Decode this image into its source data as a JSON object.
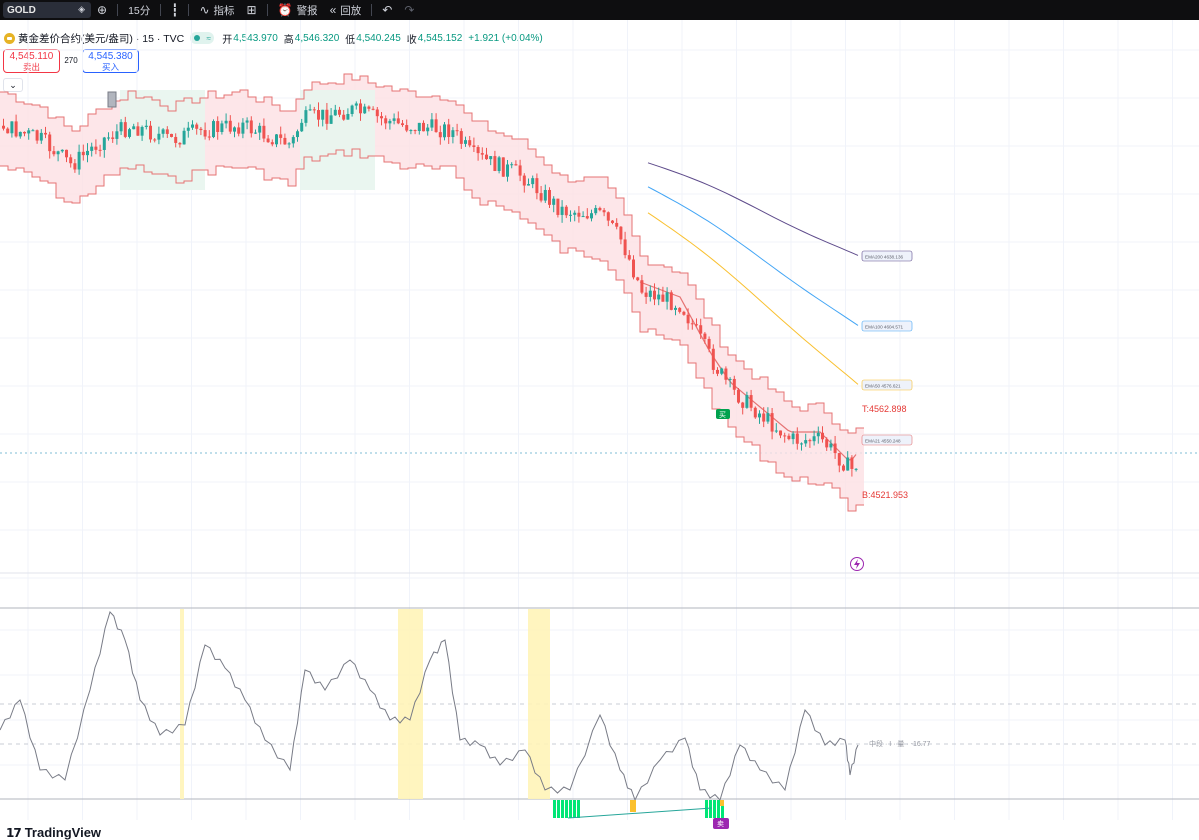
{
  "toolbar": {
    "symbol": "GOLD",
    "interval": "15分",
    "indicators_label": "指标",
    "alerts_label": "警报",
    "replay_label": "回放"
  },
  "legend": {
    "title": "黄金差价合约(美元/盎司) · 15 · TVC",
    "toggle_icon": "≈",
    "open_label": "开",
    "open_value": "4,543.970",
    "high_label": "高",
    "high_value": "4,546.320",
    "low_label": "低",
    "low_value": "4,540.245",
    "close_label": "收",
    "close_value": "4,545.152",
    "change": "+1.921 (+0.04%)"
  },
  "trade": {
    "sell_price": "4,545.110",
    "sell_label": "卖出",
    "spread": "270",
    "buy_price": "4,545.380",
    "buy_label": "买入"
  },
  "labels": {
    "ema200": "EMA200 4638.136",
    "ema100": "EMA100 4604.571",
    "ema50": "EMA50 4576.621",
    "ema21": "EMA21 4550.248",
    "top_level": "T:4562.898",
    "bottom_level": "B:4521.953",
    "signal_buy": "买",
    "signal_sell": "卖",
    "osc_label": "中段 · I · 量 · -16.77",
    "watermark": "TradingView"
  },
  "colors": {
    "up": "#26a69a",
    "down": "#ef5350",
    "band_up": "#e8f5ee",
    "band_down": "#fde0e4",
    "band_edge_down": "#e57373",
    "band_edge_up": "#66bb6a",
    "ema200": "#5e4b8b",
    "ema100": "#42a5f5",
    "ema50": "#f9c02f",
    "ema21": "#e57373",
    "highlight": "#fff4b8"
  }
}
